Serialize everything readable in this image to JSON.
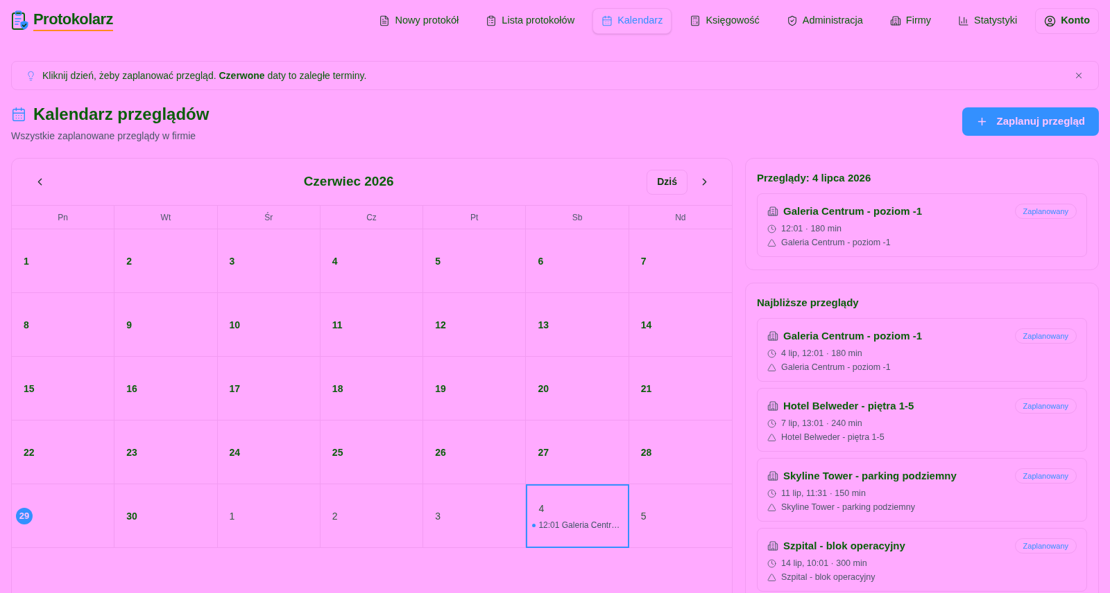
{
  "header": {
    "logo": "Protokolarz",
    "nav": [
      {
        "label": "Nowy protokół",
        "selected": false
      },
      {
        "label": "Lista protokołów",
        "selected": false
      },
      {
        "label": "Kalendarz",
        "selected": true
      },
      {
        "label": "Księgowość",
        "selected": false
      },
      {
        "label": "Administracja",
        "selected": false
      },
      {
        "label": "Firmy",
        "selected": false
      },
      {
        "label": "Statystyki",
        "selected": false
      }
    ],
    "account": "Konto"
  },
  "notice": {
    "text": "Kliknij dzień, żeby zaplanować przegląd. **Czerwone** daty to zaległe terminy."
  },
  "page": {
    "title": "Kalendarz przeglądów",
    "subtitle": "Wszystkie zaplanowane przeglądy w firmie",
    "action": "Zaplanuj przegląd"
  },
  "calendar": {
    "month": "Czerwiec 2026",
    "today_button": "Dziś",
    "weekdays": [
      "Pn",
      "Wt",
      "Śr",
      "Cz",
      "Pt",
      "Sb",
      "Nd"
    ],
    "weeks": [
      [
        {
          "day": "1",
          "in_month": true,
          "today": false,
          "selected": false
        },
        {
          "day": "2",
          "in_month": true,
          "today": false,
          "selected": false
        },
        {
          "day": "3",
          "in_month": true,
          "today": false,
          "selected": false
        },
        {
          "day": "4",
          "in_month": true,
          "today": false,
          "selected": false
        },
        {
          "day": "5",
          "in_month": true,
          "today": false,
          "selected": false
        },
        {
          "day": "6",
          "in_month": true,
          "today": false,
          "selected": false
        },
        {
          "day": "7",
          "in_month": true,
          "today": false,
          "selected": false
        }
      ],
      [
        {
          "day": "8",
          "in_month": true,
          "today": false,
          "selected": false
        },
        {
          "day": "9",
          "in_month": true,
          "today": false,
          "selected": false
        },
        {
          "day": "10",
          "in_month": true,
          "today": false,
          "selected": false
        },
        {
          "day": "11",
          "in_month": true,
          "today": false,
          "selected": false
        },
        {
          "day": "12",
          "in_month": true,
          "today": false,
          "selected": false
        },
        {
          "day": "13",
          "in_month": true,
          "today": false,
          "selected": false
        },
        {
          "day": "14",
          "in_month": true,
          "today": false,
          "selected": false
        }
      ],
      [
        {
          "day": "15",
          "in_month": true,
          "today": false,
          "selected": false
        },
        {
          "day": "16",
          "in_month": true,
          "today": false,
          "selected": false
        },
        {
          "day": "17",
          "in_month": true,
          "today": false,
          "selected": false
        },
        {
          "day": "18",
          "in_month": true,
          "today": false,
          "selected": false
        },
        {
          "day": "19",
          "in_month": true,
          "today": false,
          "selected": false
        },
        {
          "day": "20",
          "in_month": true,
          "today": false,
          "selected": false
        },
        {
          "day": "21",
          "in_month": true,
          "today": false,
          "selected": false
        }
      ],
      [
        {
          "day": "22",
          "in_month": true,
          "today": false,
          "selected": false
        },
        {
          "day": "23",
          "in_month": true,
          "today": false,
          "selected": false
        },
        {
          "day": "24",
          "in_month": true,
          "today": false,
          "selected": false
        },
        {
          "day": "25",
          "in_month": true,
          "today": false,
          "selected": false
        },
        {
          "day": "26",
          "in_month": true,
          "today": false,
          "selected": false
        },
        {
          "day": "27",
          "in_month": true,
          "today": false,
          "selected": false
        },
        {
          "day": "28",
          "in_month": true,
          "today": false,
          "selected": false
        }
      ],
      [
        {
          "day": "29",
          "in_month": true,
          "today": true,
          "selected": false
        },
        {
          "day": "30",
          "in_month": true,
          "today": false,
          "selected": false
        },
        {
          "day": "1",
          "in_month": false,
          "today": false,
          "selected": false
        },
        {
          "day": "2",
          "in_month": false,
          "today": false,
          "selected": false
        },
        {
          "day": "3",
          "in_month": false,
          "today": false,
          "selected": false
        },
        {
          "day": "4",
          "in_month": false,
          "today": false,
          "selected": true,
          "events": [
            {
              "text": "12:01 Galeria Centr…"
            }
          ]
        },
        {
          "day": "5",
          "in_month": false,
          "today": false,
          "selected": false
        }
      ]
    ]
  },
  "selected_day": {
    "title": "Przeglądy: 4 lipca 2026",
    "items": [
      {
        "title": "Galeria Centrum - poziom -1",
        "status": "Zaplanowany",
        "time": "12:01 · 180 min",
        "location": "Galeria Centrum - poziom -1"
      }
    ]
  },
  "upcoming": {
    "title": "Najbliższe przeglądy",
    "items": [
      {
        "title": "Galeria Centrum - poziom -1",
        "status": "Zaplanowany",
        "time": "4 lip, 12:01 · 180 min",
        "location": "Galeria Centrum - poziom -1"
      },
      {
        "title": "Hotel Belweder - piętra 1-5",
        "status": "Zaplanowany",
        "time": "7 lip, 13:01 · 240 min",
        "location": "Hotel Belweder - piętra 1-5"
      },
      {
        "title": "Skyline Tower - parking podziemny",
        "status": "Zaplanowany",
        "time": "11 lip, 11:31 · 150 min",
        "location": "Skyline Tower - parking podziemny"
      },
      {
        "title": "Szpital - blok operacyjny",
        "status": "Zaplanowany",
        "time": "14 lip, 10:01 · 300 min",
        "location": "Szpital - blok operacyjny"
      }
    ]
  }
}
